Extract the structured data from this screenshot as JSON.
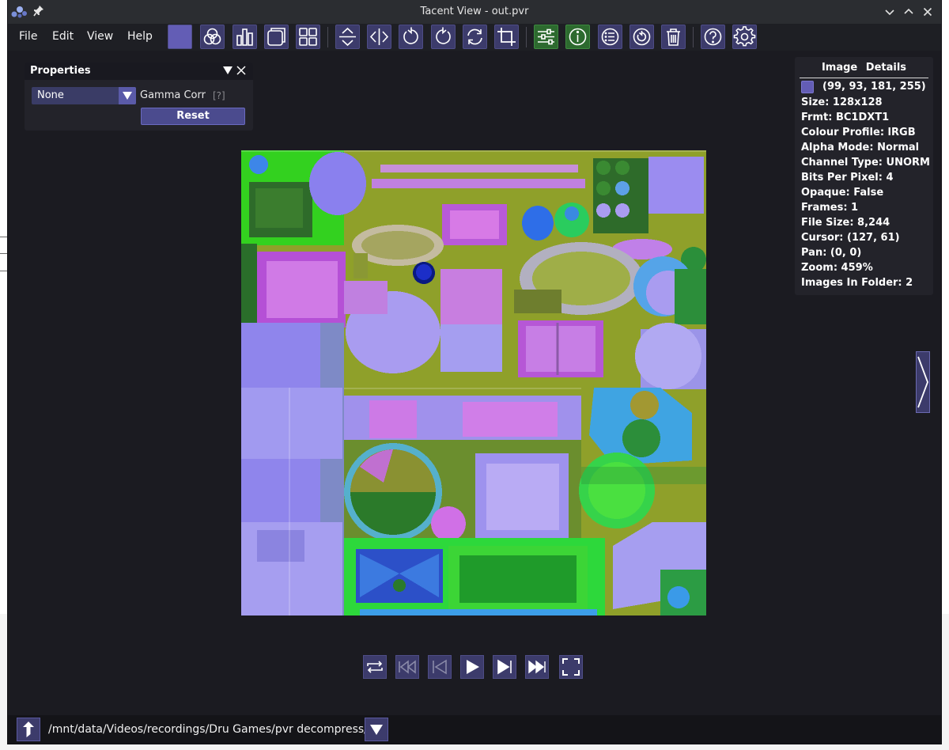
{
  "window": {
    "title": "Tacent View - out.pvr"
  },
  "titlebar_icons": [
    "app-logo-icon",
    "pin-icon",
    "minimize-chevron-icon",
    "maximize-chevron-icon",
    "close-icon"
  ],
  "menu": {
    "items": [
      {
        "label": "File"
      },
      {
        "label": "Edit"
      },
      {
        "label": "View"
      },
      {
        "label": "Help"
      }
    ]
  },
  "toolbar": {
    "buttons": [
      "color-swatch-icon",
      "channels-icon",
      "bar-chart-icon",
      "tile-icon",
      "grid-icon",
      "flip-vertical-icon",
      "flip-horizontal-icon",
      "rotate-left-icon",
      "rotate-right-icon",
      "rotate-any-icon",
      "crop-icon",
      "adjust-icon",
      "info-icon",
      "list-icon",
      "refresh-icon",
      "trash-icon",
      "help-icon",
      "settings-icon"
    ],
    "active": [
      "adjust-icon",
      "info-icon"
    ]
  },
  "properties": {
    "title": "Properties",
    "mode_value": "None",
    "gamma_label": "Gamma Corr",
    "help_marker": "[?]",
    "reset_label": "Reset"
  },
  "details": {
    "header": "Image Details",
    "pixel_color_hex": "#635db5",
    "pixel_rgba": "(99, 93, 181, 255)",
    "lines": [
      "Size: 128x128",
      "Frmt: BC1DXT1",
      "Colour Profile: lRGB",
      "Alpha Mode: Normal",
      "Channel Type: UNORM",
      "Bits Per Pixel: 4",
      "Opaque: False",
      "Frames: 1",
      "File Size: 8,244",
      "Cursor: (127, 61)",
      "Pan: (0, 0)",
      "Zoom: 459%",
      "Images In Folder: 2"
    ]
  },
  "playback": {
    "buttons": [
      "loop-icon",
      "skip-first-icon",
      "prev-frame-icon",
      "play-icon",
      "next-frame-icon",
      "skip-last-icon",
      "fullscreen-icon"
    ]
  },
  "pathbar": {
    "path": "/mnt/data/Videos/recordings/Dru Games/pvr decompress/"
  },
  "colors": {
    "accent": "#3c3b6b",
    "accent_border": "#4e4d86",
    "active_green": "#2d6a2f",
    "background": "#1b1b21"
  }
}
